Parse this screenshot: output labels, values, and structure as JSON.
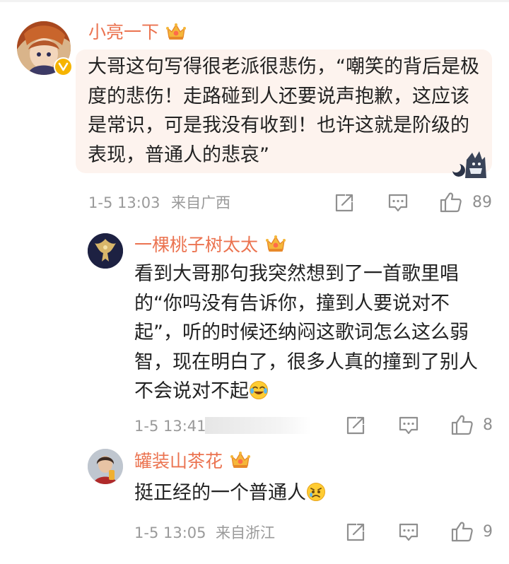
{
  "comments": [
    {
      "username": "小亮一下",
      "text": "大哥这句写得很老派很悲伤，“嘲笑的背后是极度的悲伤！走路碰到人还要说声抱歉，这应该是常识，可是我没有收到！也许这就是阶级的表现，普通人的悲哀”",
      "time": "1-5 13:03",
      "location": "来自广西",
      "like_count": "89",
      "verified_badge": "verified-v-badge",
      "crown_icon": "vip-crown-icon"
    },
    {
      "username": "一棵桃子树太太",
      "text": "看到大哥那句我突然想到了一首歌里唱的“你吗没有告诉你，撞到人要说对不起”，听的时候还纳闷这歌词怎么这么弱智，现在明白了，很多人真的撞到了别人不会说对不起",
      "emoji": "laughing-crying-emoji",
      "time": "1-5 13:41",
      "location": "",
      "like_count": "8",
      "crown_icon": "vip-crown-icon"
    },
    {
      "username": "罐装山茶花",
      "text": "挺正经的一个普通人",
      "emoji": "worried-emoji",
      "time": "1-5 13:05",
      "location": "来自浙江",
      "like_count": "9",
      "crown_icon": "vip-crown-icon"
    }
  ],
  "actions": {
    "share_icon": "share-icon",
    "comment_icon": "comment-icon",
    "like_icon": "thumbs-up-icon"
  },
  "colors": {
    "username": "#eb7350",
    "bubble_bg": "#fdf3ee",
    "meta": "#9a9a9a",
    "icon": "#8f8f8f"
  }
}
